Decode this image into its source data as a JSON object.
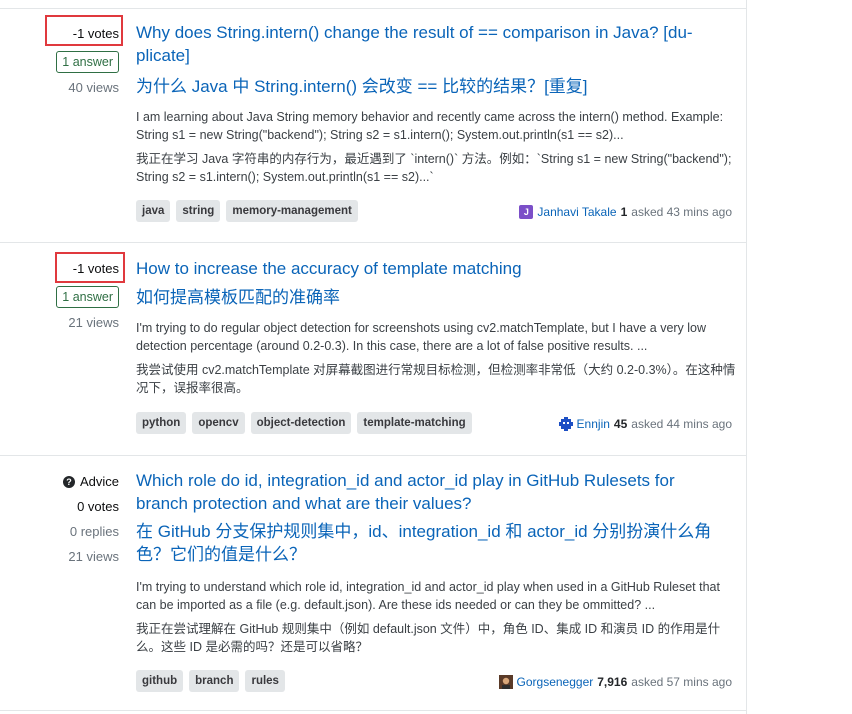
{
  "questions": [
    {
      "votes": "-1 votes",
      "answers": "1 answer",
      "views": "40 views",
      "title": "Why does String.intern() change the result of == comparison in Java? [du-plicate]",
      "title_zh": "为什么 Java 中 String.intern() 会改变 == 比较的结果？[重复]",
      "excerpt": "I am learning about Java String memory behavior and recently came across the intern() method. Example: String s1 = new String(\"backend\"); String s2 = s1.intern(); System.out.println(s1 == s2)...",
      "excerpt_zh": "我正在学习 Java 字符串的内存行为，最近遇到了 `intern()` 方法。例如：`String s1 = new String(\"backend\"); String s2 = s1.intern(); System.out.println(s1 == s2)...`",
      "tags": [
        "java",
        "string",
        "memory-management"
      ],
      "user": {
        "name": "Janhavi Takale",
        "rep": "1",
        "when": "asked 43 mins ago",
        "avatar_letter": "J",
        "avatar_color": "#7b4fc8"
      }
    },
    {
      "votes": "-1 votes",
      "answers": "1 answer",
      "views": "21 views",
      "title": "How to increase the accuracy of template matching",
      "title_zh": "如何提高模板匹配的准确率",
      "excerpt": "I'm trying to do regular object detection for screenshots using cv2.matchTemplate, but I have a very low detection percentage (around 0.2-0.3). In this case, there are a lot of false positive results. ...",
      "excerpt_zh": "我尝试使用 cv2.matchTemplate 对屏幕截图进行常规目标检测，但检测率非常低（大约 0.2-0.3%）。在这种情况下，误报率很高。",
      "tags": [
        "python",
        "opencv",
        "object-detection",
        "template-matching"
      ],
      "user": {
        "name": "Ennjin",
        "rep": "45",
        "when": "asked 44 mins ago",
        "avatar_letter": "",
        "avatar_color": "#1c4fc4"
      }
    },
    {
      "advice": "Advice",
      "votes": "0 votes",
      "replies": "0 replies",
      "views": "21 views",
      "title": "Which role do id, integration_id and actor_id play in GitHub Rulesets for branch protection and what are their values?",
      "title_zh": "在 GitHub 分支保护规则集中，id、integration_id 和 actor_id 分别扮演什么角色？它们的值是什么？",
      "excerpt": "I'm trying to understand which role id, integration_id and actor_id play when used in a GitHub Ruleset that can be imported as a file (e.g. default.json). Are these ids needed or can they be ommitted? ...",
      "excerpt_zh": "我正在尝试理解在 GitHub 规则集中（例如 default.json 文件）中，角色 ID、集成 ID 和演员 ID 的作用是什么。这些 ID 是必需的吗？还是可以省略？",
      "tags": [
        "github",
        "branch",
        "rules"
      ],
      "user": {
        "name": "Gorgsenegger",
        "rep": "7,916",
        "when": "asked 57 mins ago",
        "avatar_letter": "",
        "avatar_color": "#8a4b2a"
      }
    }
  ]
}
